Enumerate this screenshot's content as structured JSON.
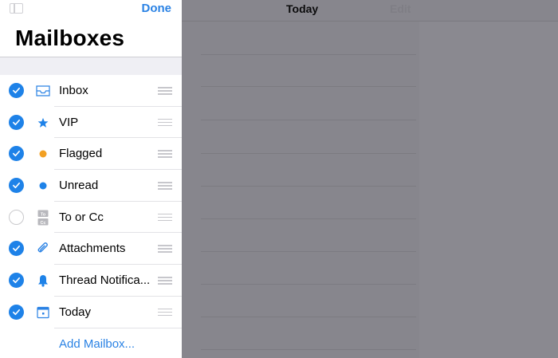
{
  "mailboxes_panel": {
    "done_label": "Done",
    "title": "Mailboxes",
    "add_mailbox_label": "Add Mailbox...",
    "items": [
      {
        "label": "Inbox",
        "checked": true,
        "icon": "inbox-icon"
      },
      {
        "label": "VIP",
        "checked": true,
        "icon": "star-icon"
      },
      {
        "label": "Flagged",
        "checked": true,
        "icon": "flag-dot-icon"
      },
      {
        "label": "Unread",
        "checked": true,
        "icon": "unread-dot-icon"
      },
      {
        "label": "To or Cc",
        "checked": false,
        "icon": "to-cc-icon"
      },
      {
        "label": "Attachments",
        "checked": true,
        "icon": "paperclip-icon"
      },
      {
        "label": "Thread Notifica...",
        "checked": true,
        "icon": "bell-icon"
      },
      {
        "label": "Today",
        "checked": true,
        "icon": "calendar-icon"
      }
    ]
  },
  "message_list": {
    "title": "Today",
    "edit_label": "Edit"
  },
  "colors": {
    "accent": "#2a82e4",
    "checkbox": "#1e82e8",
    "flagged": "#f2a023",
    "overlay": "#87868d"
  }
}
